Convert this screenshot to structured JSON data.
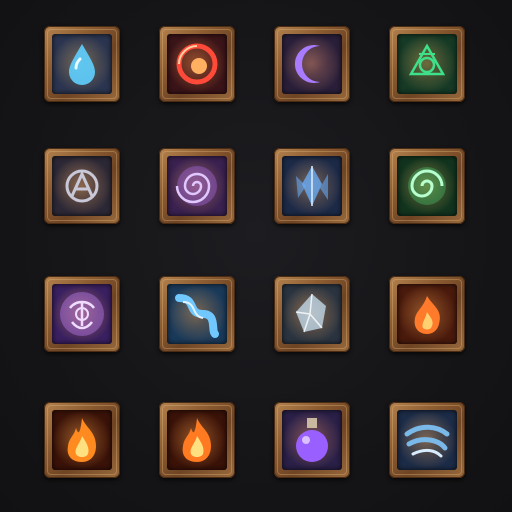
{
  "grid": {
    "rows": [
      [
        {
          "icon": "water-drop-icon",
          "bg": "#2b3550",
          "glow": "#5fd0ff"
        },
        {
          "icon": "fire-orb-icon",
          "bg": "#3a1418",
          "glow": "#ff4a3a"
        },
        {
          "icon": "crescent-moon-icon",
          "bg": "#2a1f3a",
          "glow": "#a87bff"
        },
        {
          "icon": "nature-rune-icon",
          "bg": "#163a26",
          "glow": "#3fe08a"
        }
      ],
      [
        {
          "icon": "arcane-sigil-icon",
          "bg": "#2c2836",
          "glow": "#c8c8d8"
        },
        {
          "icon": "void-swirl-icon",
          "bg": "#3a2150",
          "glow": "#b070ff"
        },
        {
          "icon": "ice-shard-icon",
          "bg": "#1c2a48",
          "glow": "#6ab0ff"
        },
        {
          "icon": "poison-vortex-icon",
          "bg": "#12341e",
          "glow": "#44e07a"
        }
      ],
      [
        {
          "icon": "shadow-curse-icon",
          "bg": "#3a2060",
          "glow": "#c080ff"
        },
        {
          "icon": "water-wave-icon",
          "bg": "#1a3a5a",
          "glow": "#70c8ff"
        },
        {
          "icon": "crystal-icon",
          "bg": "#2a3440",
          "glow": "#c0d8e8"
        },
        {
          "icon": "flame-icon",
          "bg": "#4a1a0c",
          "glow": "#ff7a2a"
        }
      ],
      [
        {
          "icon": "fire-icon",
          "bg": "#3a1208",
          "glow": "#ff8a20"
        },
        {
          "icon": "fire-icon",
          "bg": "#3a1208",
          "glow": "#ff7a20"
        },
        {
          "icon": "potion-icon",
          "bg": "#2a2048",
          "glow": "#9a60ff"
        },
        {
          "icon": "wind-gust-icon",
          "bg": "#1c2c48",
          "glow": "#7ab8e8"
        }
      ]
    ]
  }
}
